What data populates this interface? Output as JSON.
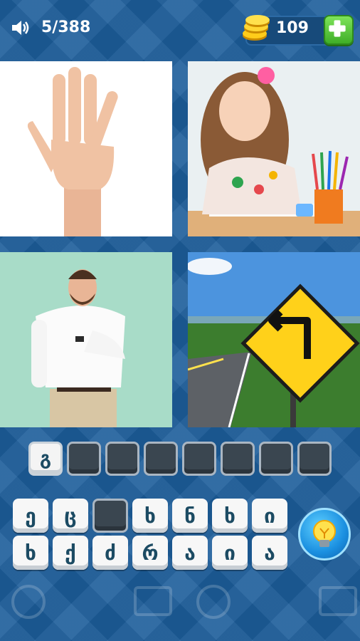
{
  "header": {
    "level_progress": "5/388",
    "coins": "109"
  },
  "icons": {
    "sound": "speaker-icon",
    "coins": "coin-stack-icon",
    "add": "plus-icon",
    "hint": "lightbulb-icon"
  },
  "pictures": [
    {
      "name": "picture-hand"
    },
    {
      "name": "picture-girl-drawing"
    },
    {
      "name": "picture-man-pointing"
    },
    {
      "name": "picture-road-sign"
    }
  ],
  "answer": {
    "slots": [
      "გ",
      "",
      "",
      "",
      "",
      "",
      "",
      ""
    ]
  },
  "keyboard": {
    "row1": [
      "ე",
      "ც",
      "",
      "ხ",
      "ნ",
      "ხ",
      "ი"
    ],
    "row2": [
      "ხ",
      "ქ",
      "ძ",
      "რ",
      "ა",
      "ი",
      "ა"
    ]
  },
  "colors": {
    "background": "#1c5d9a",
    "add_button": "#4fc332",
    "key_text": "#1c4b63"
  }
}
